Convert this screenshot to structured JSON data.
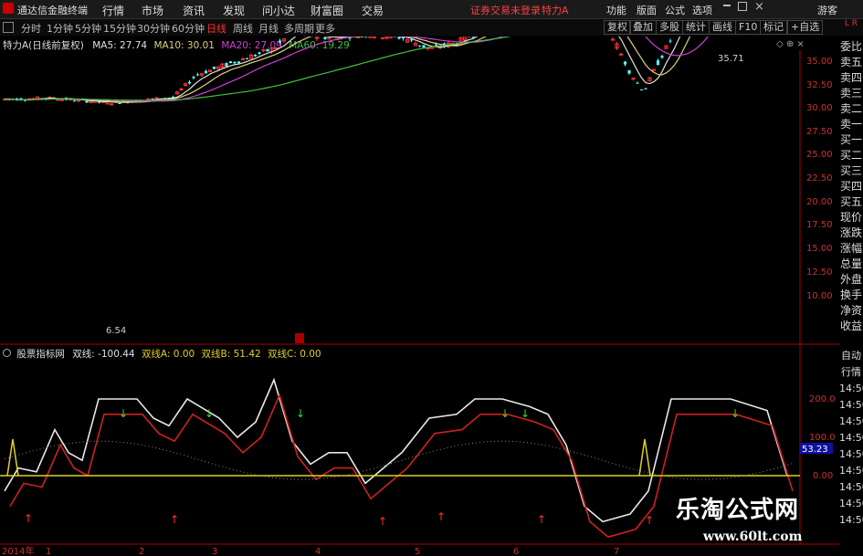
{
  "menubar": {
    "app_title": "通达信金融终端",
    "items": [
      "行情",
      "市场",
      "资讯",
      "发现",
      "问小达",
      "财富圈",
      "交易"
    ],
    "login_status": "证券交易未登录",
    "stock_title": "特力A",
    "right_items": [
      "功能",
      "版面",
      "公式",
      "选项"
    ],
    "guest": "游客"
  },
  "periods": {
    "items": [
      "分时",
      "1分钟",
      "5分钟",
      "15分钟",
      "30分钟",
      "60分钟",
      "日线",
      "周线",
      "月线",
      "多周期",
      "更多"
    ],
    "active": "日线"
  },
  "tools": [
    "复权",
    "叠加",
    "多股",
    "统计",
    "画线",
    "F10",
    "标记",
    "+自选"
  ],
  "main_chart": {
    "title": "特力A(日线前复权)",
    "ma": [
      {
        "label": "MA5: 27.74",
        "color": "#e0e0e0"
      },
      {
        "label": "MA10: 30.01",
        "color": "#e0d080"
      },
      {
        "label": "MA20: 27.09",
        "color": "#d040d0"
      },
      {
        "label": "MA60: 19.29",
        "color": "#40c040"
      }
    ],
    "high_label": "35.71",
    "low_label": "6.54",
    "y_ticks": [
      "35.00",
      "32.50",
      "30.00",
      "27.50",
      "25.00",
      "22.50",
      "20.00",
      "17.50",
      "15.00",
      "12.50",
      "10.00"
    ]
  },
  "sub_chart": {
    "title": "股票指标网",
    "lines": [
      {
        "label": "双线: -100.44",
        "color": "#e0e0e0"
      },
      {
        "label": "双线A: 0.00",
        "color": "#e0d020"
      },
      {
        "label": "双线B: 51.42",
        "color": "#e0d020"
      },
      {
        "label": "双线C: 0.00",
        "color": "#e0d020"
      }
    ],
    "y_ticks": [
      "200.0",
      "100.0",
      "0.00"
    ],
    "current_value": "53.23"
  },
  "right_panel": {
    "tabs": [
      "委比",
      "卖五",
      "卖四",
      "卖三",
      "卖二",
      "卖一",
      "买一",
      "买二",
      "买三",
      "买四",
      "买五",
      "现价",
      "涨跌",
      "涨幅",
      "总量",
      "外盘",
      "换手",
      "净资",
      "收益"
    ],
    "lower": [
      "自动",
      "行情",
      "14:50",
      "14:50",
      "14:50",
      "14:50",
      "14:50",
      "14:50",
      "14:50",
      "14:50",
      "14:50"
    ]
  },
  "x_axis": [
    "2014年",
    "1",
    "2",
    "3",
    "4",
    "5",
    "6",
    "7"
  ],
  "watermark": {
    "text": "乐淘公式网",
    "url": "www.60lt.com"
  },
  "colors": {
    "up": "#ff3232",
    "down": "#54ffff",
    "accent": "#ff3030"
  }
}
